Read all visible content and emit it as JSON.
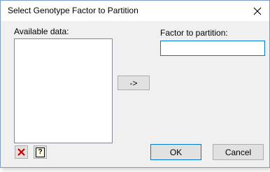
{
  "window": {
    "title": "Select Genotype Factor to Partition",
    "close_glyph": "✕"
  },
  "available": {
    "label": "Available data:",
    "items": []
  },
  "transfer": {
    "label": "->"
  },
  "factor": {
    "label": "Factor to partition:",
    "value": ""
  },
  "buttons": {
    "ok": "OK",
    "cancel": "Cancel"
  },
  "icons": {
    "clear": "red-x-icon",
    "help": "help-icon",
    "help_glyph": "?"
  },
  "colors": {
    "accent": "#0078d7",
    "clear_red": "#c00000"
  }
}
